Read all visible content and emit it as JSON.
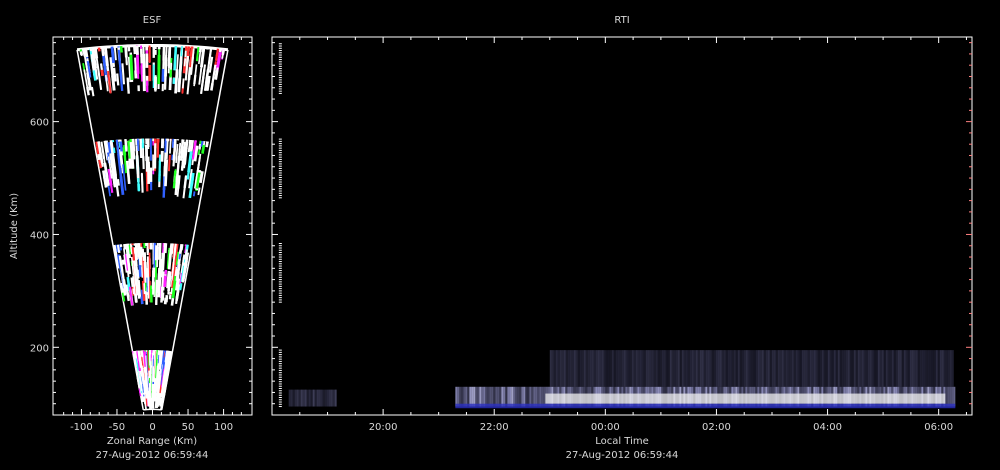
{
  "colors": {
    "background": "#000000",
    "axis": "#ffffff",
    "text": "#d8d8d8",
    "scatter": [
      "#ffffff",
      "#20ff20",
      "#ff20ff",
      "#ffffff",
      "#ffffff",
      "#40ffff",
      "#ff3030",
      "#3060ff"
    ],
    "rti_tint": "#ff8080"
  },
  "chart_data": [
    {
      "type": "scatter",
      "title": "ESF",
      "xlabel": "Zonal Range (Km)",
      "ylabel": "Altitude (Km)",
      "timestamp": "27-Aug-2012 06:59:44",
      "xlim": [
        -140,
        140
      ],
      "ylim": [
        80,
        750
      ],
      "x_ticks": [
        -100,
        -50,
        0,
        50,
        100
      ],
      "x_tick_labels": [
        "-100",
        "-50",
        "0",
        "50",
        "100"
      ],
      "y_ticks": [
        200,
        400,
        600
      ],
      "y_tick_labels": [
        "200",
        "400",
        "600"
      ],
      "fan_min_altitude": 90,
      "fan_max_altitude": 735,
      "fan_half_angle_deg": 8.3,
      "echo_bands": [
        {
          "altitude_min": 90,
          "altitude_max": 195
        },
        {
          "altitude_min": 275,
          "altitude_max": 385
        },
        {
          "altitude_min": 465,
          "altitude_max": 570
        },
        {
          "altitude_min": 650,
          "altitude_max": 735
        }
      ]
    },
    {
      "type": "heatmap",
      "title": "RTI",
      "xlabel": "Local Time",
      "ylabel": "Altitude (Km)",
      "timestamp": "27-Aug-2012 06:59:44",
      "xlim": [
        18.0,
        25.1
      ],
      "ylim": [
        80,
        750
      ],
      "x_ticks": [
        20,
        22,
        24,
        26,
        28,
        30
      ],
      "x_tick_labels": [
        "20:00",
        "22:00",
        "00:00",
        "02:00",
        "04:00",
        "06:00"
      ],
      "y_ticks": [
        200,
        400,
        600
      ],
      "echo_layers": [
        {
          "time_start": 18.3,
          "time_end": 19.2,
          "altitude_min": 95,
          "altitude_max": 125,
          "intensity": 0.45
        },
        {
          "time_start": 21.3,
          "time_end": 30.3,
          "altitude_min": 95,
          "altitude_max": 130,
          "intensity": 0.95
        },
        {
          "time_start": 23.0,
          "time_end": 30.3,
          "altitude_min": 130,
          "altitude_max": 195,
          "intensity": 0.35
        }
      ],
      "marker_columns": [
        {
          "time": 18.15,
          "altitude_min": 650,
          "altitude_max": 740
        },
        {
          "time": 18.15,
          "altitude_min": 465,
          "altitude_max": 570
        },
        {
          "time": 18.15,
          "altitude_min": 280,
          "altitude_max": 385
        },
        {
          "time": 18.15,
          "altitude_min": 95,
          "altitude_max": 195
        }
      ]
    }
  ]
}
